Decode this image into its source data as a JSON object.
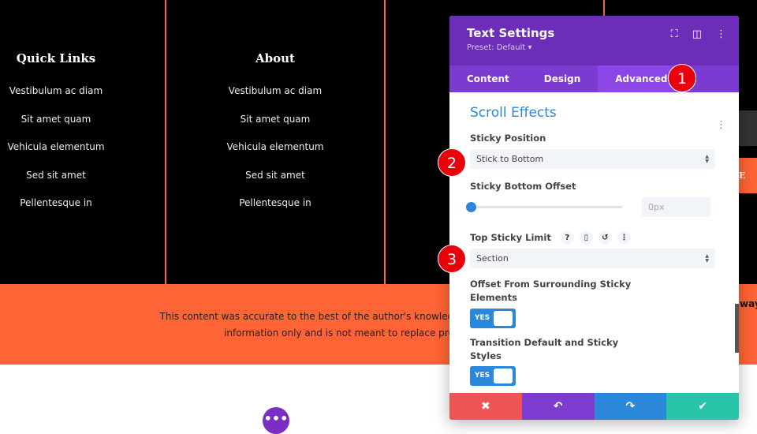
{
  "footer": {
    "columns": [
      {
        "title": "Quick Links",
        "links": [
          "Vestibulum ac diam",
          "Sit amet quam",
          "Vehicula elementum",
          "Sed sit amet",
          "Pellentesque in"
        ]
      },
      {
        "title": "About",
        "links": [
          "Vestibulum ac diam",
          "Sit amet quam",
          "Vehicula elementum",
          "Sed sit amet",
          "Pellentesque in"
        ]
      }
    ]
  },
  "banner": {
    "text": "This content was accurate to the best of the author's knowledge at the time of writing. It is i",
    "text2": "information only and is not meant to replace professional advice."
  },
  "right": {
    "button_text": "E",
    "partial_text": "way"
  },
  "panel": {
    "title": "Text Settings",
    "preset": "Preset: Default ▾",
    "tabs": [
      "Content",
      "Design",
      "Advanced"
    ],
    "active_tab": "Advanced",
    "section": "Scroll Effects",
    "sticky_position": {
      "label": "Sticky Position",
      "value": "Stick to Bottom"
    },
    "bottom_offset": {
      "label": "Sticky Bottom Offset",
      "placeholder": "0px",
      "value": 0
    },
    "top_limit": {
      "label": "Top Sticky Limit",
      "value": "Section"
    },
    "offset_surrounding": {
      "label1": "Offset From Surrounding Sticky",
      "label2": "Elements",
      "value": "YES"
    },
    "transition": {
      "label1": "Transition Default and Sticky",
      "label2": "Styles",
      "value": "YES"
    },
    "footer_colors": [
      "#ef5555",
      "#7d3bcf",
      "#2b87da",
      "#29c4a9"
    ]
  },
  "badges": [
    "1",
    "2",
    "3"
  ],
  "accent": "#ff6436"
}
